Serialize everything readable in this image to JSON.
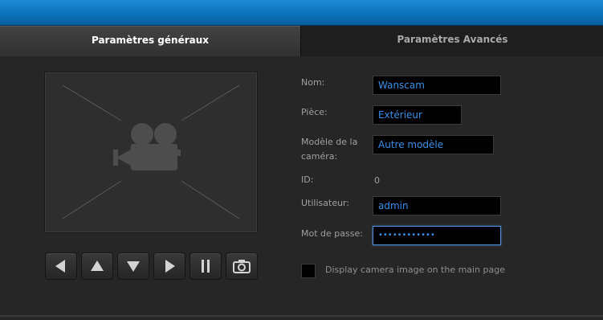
{
  "tabs": [
    {
      "label": "Paramètres généraux",
      "active": true
    },
    {
      "label": "Paramètres Avancés",
      "active": false
    }
  ],
  "preview": {
    "icon": "video-camera-icon"
  },
  "controls": [
    {
      "name": "pan-left-button",
      "icon": "arrow-left-icon"
    },
    {
      "name": "tilt-up-button",
      "icon": "arrow-up-icon"
    },
    {
      "name": "tilt-down-button",
      "icon": "arrow-down-icon"
    },
    {
      "name": "pan-right-button",
      "icon": "arrow-right-icon"
    },
    {
      "name": "pause-button",
      "icon": "pause-icon"
    },
    {
      "name": "snapshot-button",
      "icon": "camera-icon"
    }
  ],
  "form": {
    "name_label": "Nom:",
    "name_value": "Wanscam",
    "room_label": "Pièce:",
    "room_value": "Extérieur",
    "model_label_line1": "Modèle de la",
    "model_label_line2": "caméra:",
    "model_value": "Autre modèle",
    "id_label": "ID:",
    "id_value": "0",
    "user_label": "Utilisateur:",
    "user_value": "admin",
    "password_label": "Mot de passe:",
    "password_value": "••••••••••••"
  },
  "checkbox": {
    "label": "Display camera image on the main page",
    "checked": false
  },
  "colors": {
    "titlebar": "#0b6fb8",
    "field_text": "#3a8fe6",
    "focus_border": "#4c8ed6"
  }
}
